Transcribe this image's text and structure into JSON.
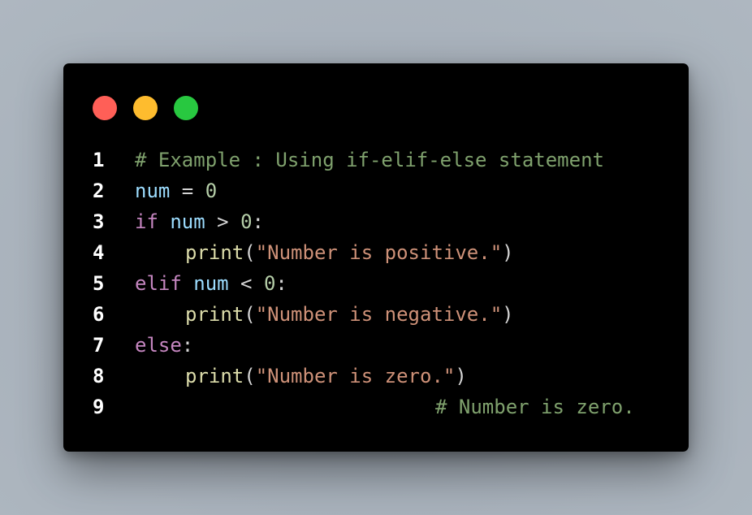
{
  "colors": {
    "comment": "#7fa16d",
    "keyword": "#c586c0",
    "variable": "#9cdcfe",
    "number": "#b5cea8",
    "function": "#dcdcaa",
    "string": "#ce9178",
    "punct": "#d4d4d4",
    "line_number": "#ffffff",
    "dot_red": "#ff5f57",
    "dot_yellow": "#febc2e",
    "dot_green": "#28c840"
  },
  "window": {
    "controls": [
      "close-dot",
      "minimize-dot",
      "maximize-dot"
    ]
  },
  "code": {
    "lines": [
      {
        "num": "1",
        "tokens": [
          {
            "t": "# Example : Using if-elif-else statement",
            "k": "comment"
          }
        ]
      },
      {
        "num": "2",
        "tokens": [
          {
            "t": "num",
            "k": "variable"
          },
          {
            "t": " = ",
            "k": "punct"
          },
          {
            "t": "0",
            "k": "number"
          }
        ]
      },
      {
        "num": "3",
        "tokens": [
          {
            "t": "if",
            "k": "keyword"
          },
          {
            "t": " ",
            "k": "punct"
          },
          {
            "t": "num",
            "k": "variable"
          },
          {
            "t": " > ",
            "k": "punct"
          },
          {
            "t": "0",
            "k": "number"
          },
          {
            "t": ":",
            "k": "punct"
          }
        ]
      },
      {
        "num": "4",
        "indent": true,
        "tokens": [
          {
            "t": "print",
            "k": "function"
          },
          {
            "t": "(",
            "k": "punct"
          },
          {
            "t": "\"Number is positive.\"",
            "k": "string"
          },
          {
            "t": ")",
            "k": "punct"
          }
        ]
      },
      {
        "num": "5",
        "tokens": [
          {
            "t": "elif",
            "k": "keyword"
          },
          {
            "t": " ",
            "k": "punct"
          },
          {
            "t": "num",
            "k": "variable"
          },
          {
            "t": " < ",
            "k": "punct"
          },
          {
            "t": "0",
            "k": "number"
          },
          {
            "t": ":",
            "k": "punct"
          }
        ]
      },
      {
        "num": "6",
        "indent": true,
        "tokens": [
          {
            "t": "print",
            "k": "function"
          },
          {
            "t": "(",
            "k": "punct"
          },
          {
            "t": "\"Number is negative.\"",
            "k": "string"
          },
          {
            "t": ")",
            "k": "punct"
          }
        ]
      },
      {
        "num": "7",
        "tokens": [
          {
            "t": "else",
            "k": "keyword"
          },
          {
            "t": ":",
            "k": "punct"
          }
        ]
      },
      {
        "num": "8",
        "indent": true,
        "tokens": [
          {
            "t": "print",
            "k": "function"
          },
          {
            "t": "(",
            "k": "punct"
          },
          {
            "t": "\"Number is zero.\"",
            "k": "string"
          },
          {
            "t": ")",
            "k": "punct"
          }
        ]
      },
      {
        "num": "9",
        "trailing": true,
        "tokens": [
          {
            "t": "# Number is zero.",
            "k": "comment"
          }
        ]
      }
    ]
  }
}
